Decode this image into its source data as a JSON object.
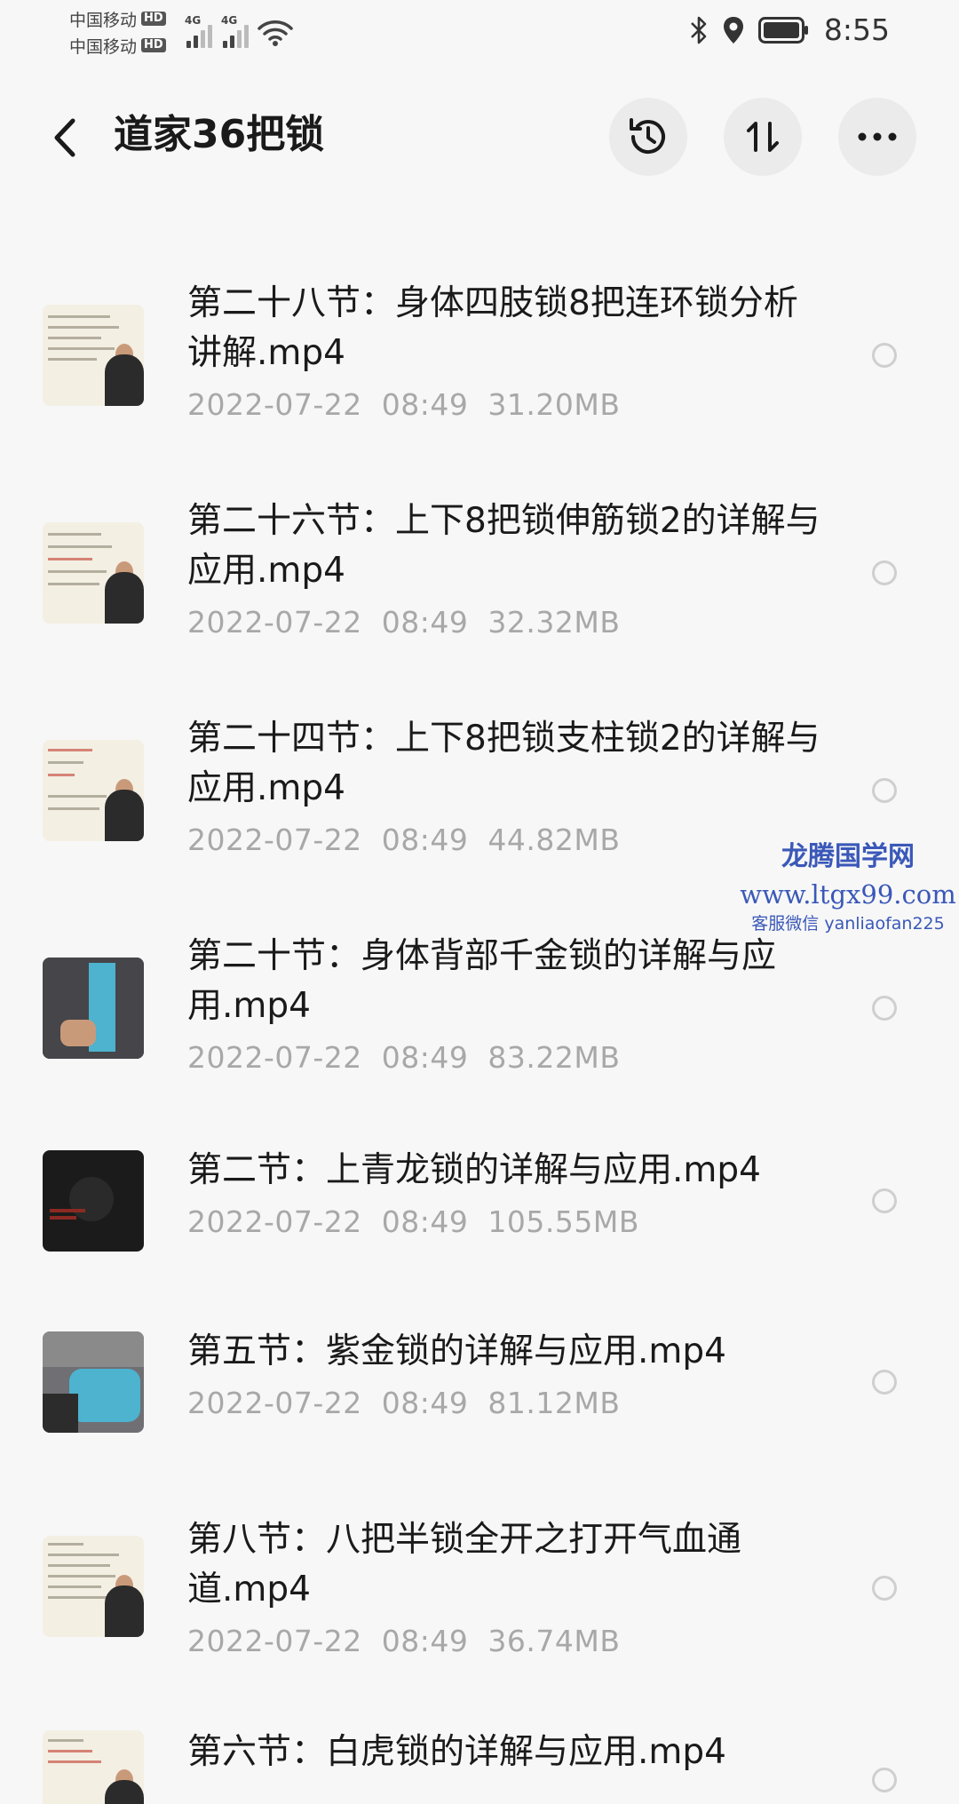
{
  "status_bar": {
    "carrier_1": "中国移动",
    "carrier_2": "中国移动",
    "hd_badge": "HD",
    "network_type": "4G",
    "time": "8:55"
  },
  "header": {
    "title": "道家36把锁"
  },
  "files": [
    {
      "name": "第二十八节：身体四肢锁8把连环锁分析讲解.mp4",
      "date": "2022-07-22",
      "time": "08:49",
      "size": "31.20MB"
    },
    {
      "name": "第二十六节：上下8把锁伸筋锁2的详解与应用.mp4",
      "date": "2022-07-22",
      "time": "08:49",
      "size": "32.32MB"
    },
    {
      "name": "第二十四节：上下8把锁支柱锁2的详解与应用.mp4",
      "date": "2022-07-22",
      "time": "08:49",
      "size": "44.82MB"
    },
    {
      "name": "第二十节：身体背部千金锁的详解与应用.mp4",
      "date": "2022-07-22",
      "time": "08:49",
      "size": "83.22MB"
    },
    {
      "name": "第二节：上青龙锁的详解与应用.mp4",
      "date": "2022-07-22",
      "time": "08:49",
      "size": "105.55MB"
    },
    {
      "name": "第五节：紫金锁的详解与应用.mp4",
      "date": "2022-07-22",
      "time": "08:49",
      "size": "81.12MB"
    },
    {
      "name": "第八节：八把半锁全开之打开气血通道.mp4",
      "date": "2022-07-22",
      "time": "08:49",
      "size": "36.74MB"
    },
    {
      "name": "第六节：白虎锁的详解与应用.mp4",
      "date": "",
      "time": "",
      "size": ""
    }
  ],
  "watermark": {
    "line1": "龙腾国学网",
    "line2": "www.ltgx99.com",
    "line3": "客服微信 yanliaofan225"
  },
  "colors": {
    "background": "#f7f7f7",
    "meta_text": "#a8a8a8",
    "watermark": "#3a58b8"
  }
}
